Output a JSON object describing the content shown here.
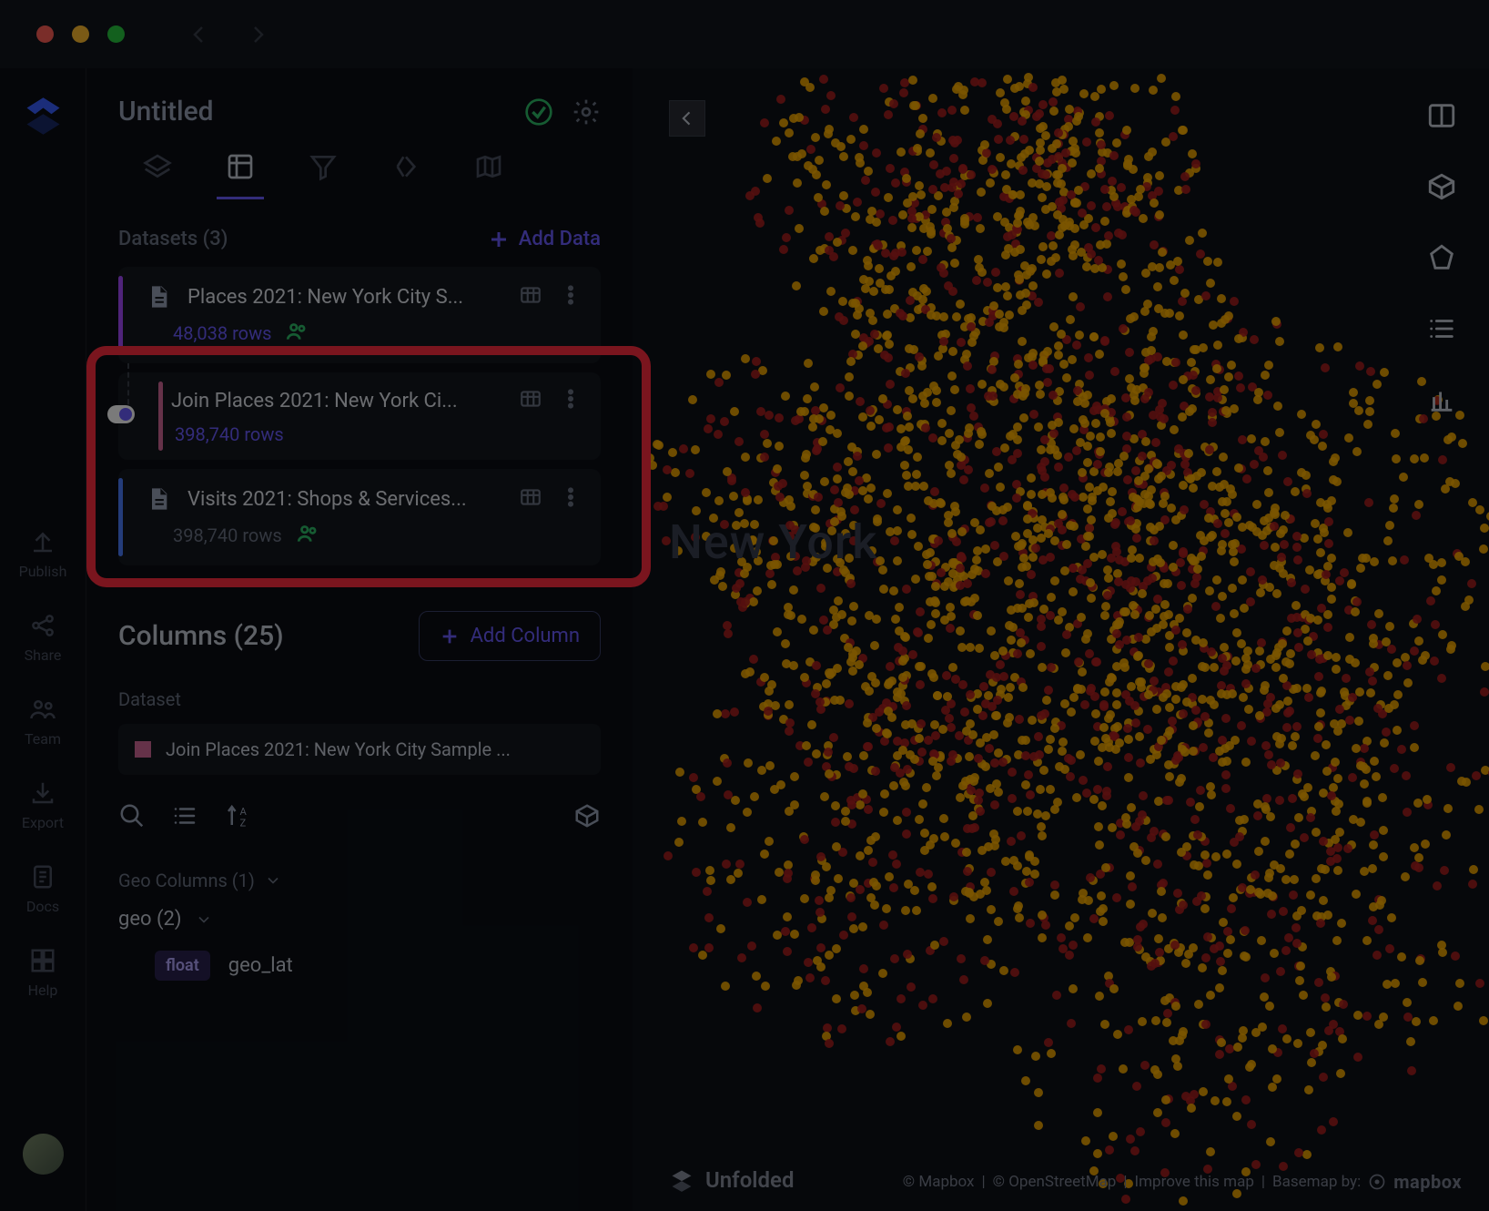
{
  "titlebar": {
    "nav_back": "‹",
    "nav_fwd": "›"
  },
  "header": {
    "title": "Untitled"
  },
  "tabs": [
    "layers",
    "columns",
    "filters",
    "interactions",
    "basemap"
  ],
  "datasets": {
    "section_label": "Datasets (3)",
    "add_label": "Add Data",
    "items": [
      {
        "name": "Places 2021: New York City S...",
        "rows": "48,038 rows",
        "color": "purple",
        "has_people_icon": true,
        "join": {
          "name": "Join Places 2021: New York Ci...",
          "rows": "398,740 rows",
          "color": "pink"
        }
      },
      {
        "name": "Visits 2021: Shops & Services...",
        "rows": "398,740 rows",
        "color": "blue",
        "has_people_icon": true
      }
    ]
  },
  "columns": {
    "section_label": "Columns (25)",
    "add_label": "Add Column",
    "dataset_label": "Dataset",
    "selected_dataset": "Join Places 2021: New York City Sample ...",
    "geo_header": "Geo Columns (1)",
    "geo_row": "geo (2)",
    "items": [
      {
        "type": "float",
        "name": "geo_lat"
      }
    ]
  },
  "map": {
    "city_label": "New York",
    "attrib_mapbox": "© Mapbox",
    "attrib_osm": "© OpenStreetMap",
    "attrib_improve": "Improve this map",
    "attrib_basemap": "Basemap by:",
    "attrib_brand": "mapbox",
    "unfolded": "Unfolded"
  },
  "rail": {
    "items": [
      {
        "label": "Publish"
      },
      {
        "label": "Share"
      },
      {
        "label": "Team"
      },
      {
        "label": "Export"
      },
      {
        "label": "Docs"
      },
      {
        "label": "Help"
      }
    ]
  }
}
